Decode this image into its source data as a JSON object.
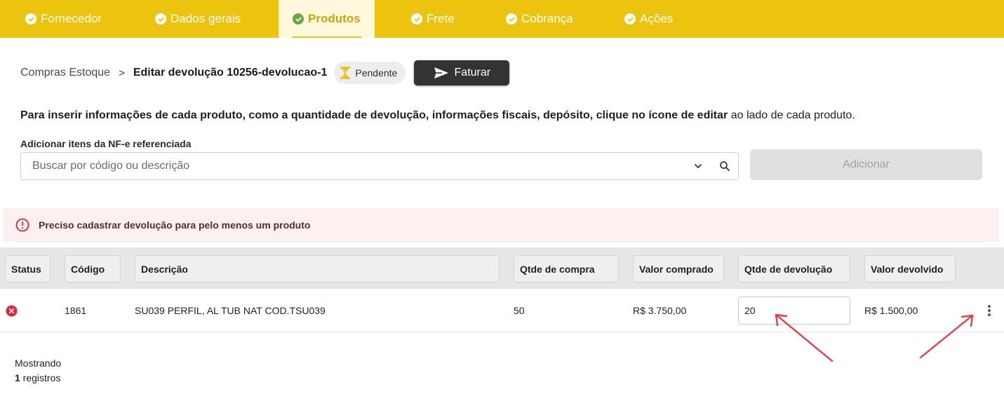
{
  "stepper": [
    {
      "label": "Fornecedor",
      "active": false
    },
    {
      "label": "Dados gerais",
      "active": false
    },
    {
      "label": "Produtos",
      "active": true
    },
    {
      "label": "Frete",
      "active": false
    },
    {
      "label": "Cobrança",
      "active": false
    },
    {
      "label": "Ações",
      "active": false
    }
  ],
  "breadcrumb": {
    "root": "Compras Estoque",
    "separator": ">",
    "current": "Editar devolução 10256-devolucao-1"
  },
  "status_badge": {
    "label": "Pendente",
    "icon": "hourglass-icon"
  },
  "faturar_button": {
    "label": "Faturar",
    "icon": "send-icon"
  },
  "instructions": {
    "bold": "Para inserir informações de cada produto, como a quantidade de devolução, informações fiscais, depósito, clique no ícone de editar",
    "rest": " ao lado de cada produto."
  },
  "nfe_search": {
    "label": "Adicionar itens da NF-e referenciada",
    "placeholder": "Buscar por código ou descrição",
    "value": ""
  },
  "add_button": {
    "label": "Adicionar"
  },
  "alert": {
    "message": "Preciso cadastrar devolução para pelo menos um produto"
  },
  "table": {
    "columns": [
      "Status",
      "Código",
      "Descrição",
      "Qtde de compra",
      "Valor comprado",
      "Qtde de devolução",
      "Valor devolvido"
    ],
    "rows": [
      {
        "status": "error",
        "codigo": "1861",
        "descricao": "SU039 PERFIL, AL TUB NAT COD.TSU039",
        "qtde_compra": "50",
        "valor_comprado": "R$ 3.750,00",
        "qtde_devolucao": "20",
        "valor_devolvido": "R$ 1.500,00"
      }
    ]
  },
  "footer": {
    "showing": "Mostrando",
    "count": "1",
    "suffix": " registros"
  },
  "colors": {
    "accent_yellow": "#ecc30e",
    "active_step_text": "#c9a40a",
    "check_green": "#6aa83a",
    "error_red": "#e0243b",
    "arrow_red": "#ee3b4a",
    "dark_button": "#333333"
  }
}
